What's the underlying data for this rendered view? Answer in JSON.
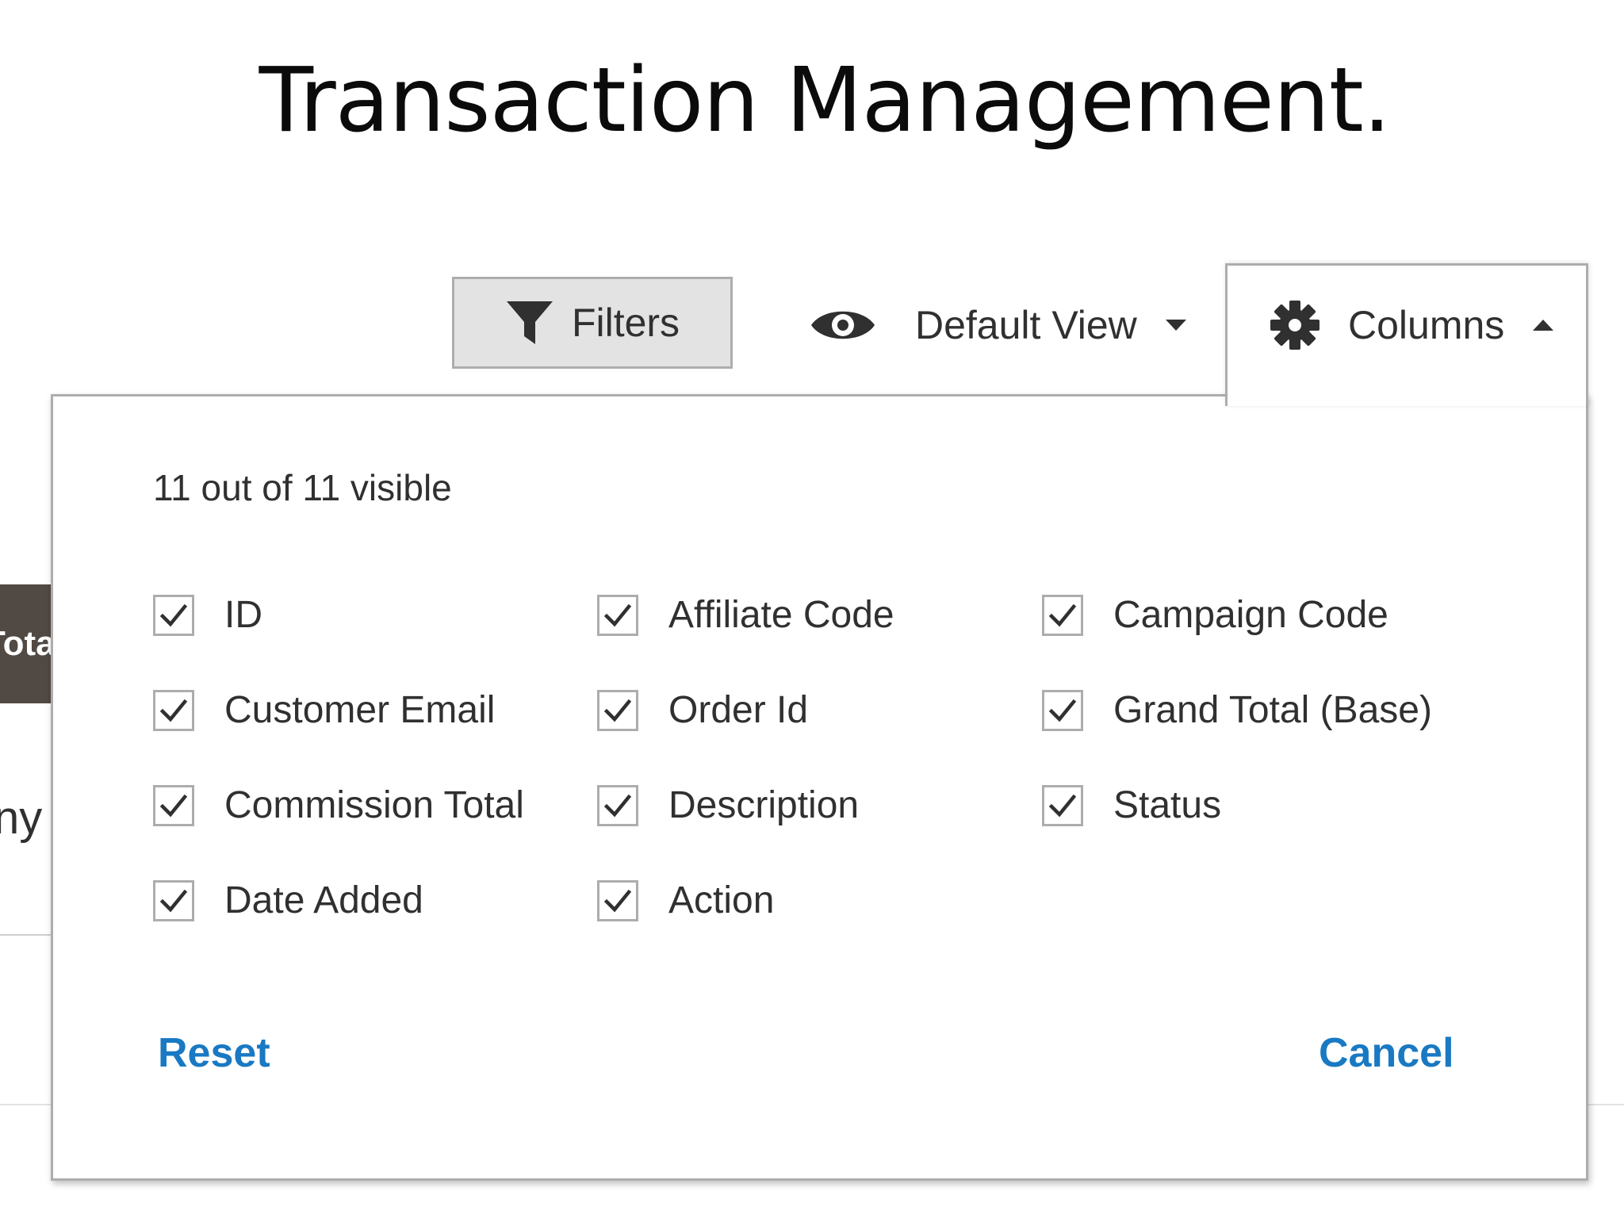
{
  "slide": {
    "title": "Transaction Management."
  },
  "background_grid": {
    "header_fragment": "Tota",
    "cell_fragment": "ny"
  },
  "toolbar": {
    "filters_label": "Filters",
    "filters_icon": "funnel-icon",
    "view_label": "Default View",
    "view_icon": "eye-icon",
    "columns_label": "Columns",
    "columns_icon": "gear-icon"
  },
  "columns_panel": {
    "visible_count": "11 out of 11 visible",
    "options": [
      {
        "label": "ID",
        "checked": true
      },
      {
        "label": "Customer Email",
        "checked": true
      },
      {
        "label": "Commission Total",
        "checked": true
      },
      {
        "label": "Date Added",
        "checked": true
      },
      {
        "label": "Affiliate Code",
        "checked": true
      },
      {
        "label": "Order Id",
        "checked": true
      },
      {
        "label": "Description",
        "checked": true
      },
      {
        "label": "Action",
        "checked": true
      },
      {
        "label": "Campaign Code",
        "checked": true
      },
      {
        "label": "Grand Total (Base)",
        "checked": true
      },
      {
        "label": "Status",
        "checked": true
      }
    ],
    "reset_label": "Reset",
    "cancel_label": "Cancel"
  },
  "colors": {
    "link": "#1979c3",
    "text": "#303030",
    "border": "#adadad",
    "button_bg": "#e3e3e3",
    "grid_header": "#514943"
  }
}
